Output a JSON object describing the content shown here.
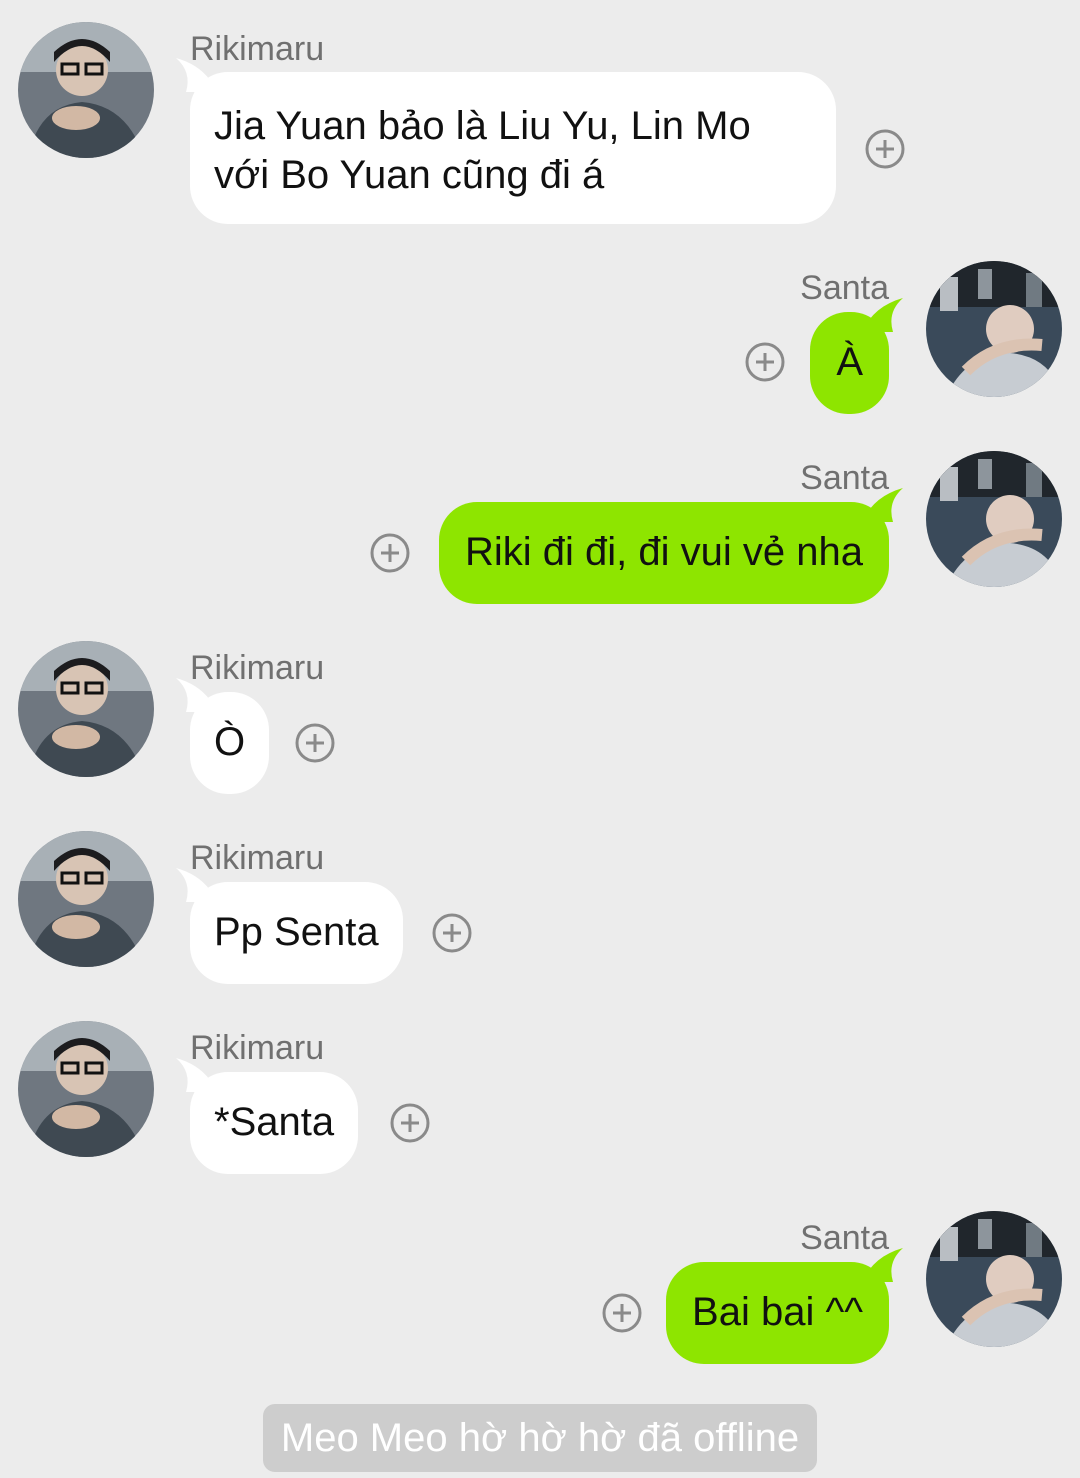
{
  "messages": [
    {
      "sender": "Rikimaru",
      "lines": [
        "Jia Yuan bảo là Liu Yu, Lin Mo",
        "với Bo Yuan cũng đi á"
      ]
    },
    {
      "sender": "Santa",
      "lines": [
        "À"
      ]
    },
    {
      "sender": "Santa",
      "lines": [
        "Riki đi đi, đi vui vẻ nha"
      ]
    },
    {
      "sender": "Rikimaru",
      "lines": [
        "Ò"
      ]
    },
    {
      "sender": "Rikimaru",
      "lines": [
        "Pp Senta"
      ]
    },
    {
      "sender": "Rikimaru",
      "lines": [
        "*Santa"
      ]
    },
    {
      "sender": "Santa",
      "lines": [
        "Bai bai ^^"
      ]
    }
  ],
  "status_text": "Meo Meo hờ hờ hờ đã offline",
  "icons": {
    "avatar": "avatar-icon",
    "add_reaction": "plus-circle-icon"
  },
  "colors": {
    "background": "#ececec",
    "incoming_bubble": "#ffffff",
    "outgoing_bubble": "#8ee500",
    "status_pill": "#cdcdcd"
  }
}
